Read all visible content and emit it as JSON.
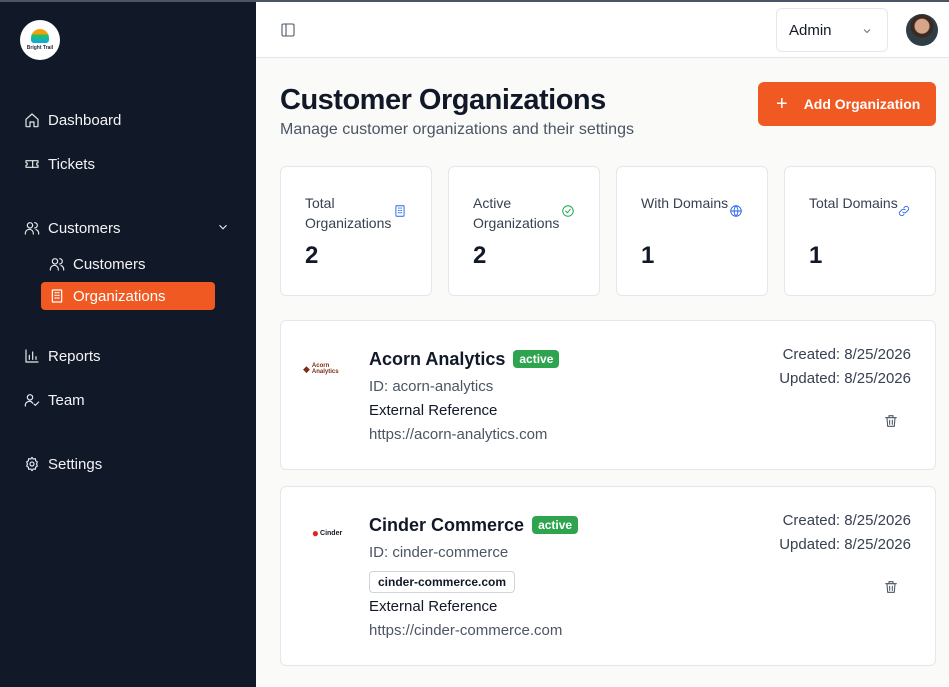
{
  "brand": {
    "name": "Bright Trail"
  },
  "sidebar": {
    "items": [
      {
        "label": "Dashboard",
        "icon": "home-icon"
      },
      {
        "label": "Tickets",
        "icon": "ticket-icon"
      },
      {
        "label": "Customers",
        "icon": "users-icon"
      },
      {
        "label": "Reports",
        "icon": "bar-chart-icon"
      },
      {
        "label": "Team",
        "icon": "user-check-icon"
      },
      {
        "label": "Settings",
        "icon": "gear-icon"
      }
    ],
    "sub_items": [
      {
        "label": "Customers",
        "icon": "users-icon"
      },
      {
        "label": "Organizations",
        "icon": "building-icon",
        "active": true
      }
    ]
  },
  "topbar": {
    "role": "Admin"
  },
  "header": {
    "title": "Customer Organizations",
    "subtitle": "Manage customer organizations and their settings",
    "add_button": "Add Organization"
  },
  "stats": [
    {
      "label": "Total Organizations",
      "value": "2",
      "icon": "building-icon"
    },
    {
      "label": "Active Organizations",
      "value": "2",
      "icon": "check-circle-icon"
    },
    {
      "label": "With Domains",
      "value": "1",
      "icon": "globe-icon"
    },
    {
      "label": "Total Domains",
      "value": "1",
      "icon": "link-icon"
    }
  ],
  "organizations": [
    {
      "name": "Acorn Analytics",
      "status": "active",
      "id": "ID: acorn-analytics",
      "logo_text": "Acorn Analytics",
      "external_label": "External Reference",
      "external_url": "https://acorn-analytics.com",
      "created": "Created: 8/25/2026",
      "updated": "Updated: 8/25/2026"
    },
    {
      "name": "Cinder Commerce",
      "status": "active",
      "id": "ID: cinder-commerce",
      "logo_text": "Cinder",
      "domain": "cinder-commerce.com",
      "external_label": "External Reference",
      "external_url": "https://cinder-commerce.com",
      "created": "Created: 8/25/2026",
      "updated": "Updated: 8/25/2026"
    }
  ],
  "colors": {
    "accent": "#f05a22",
    "sidebar_bg": "#111827",
    "badge": "#2ea44f"
  }
}
